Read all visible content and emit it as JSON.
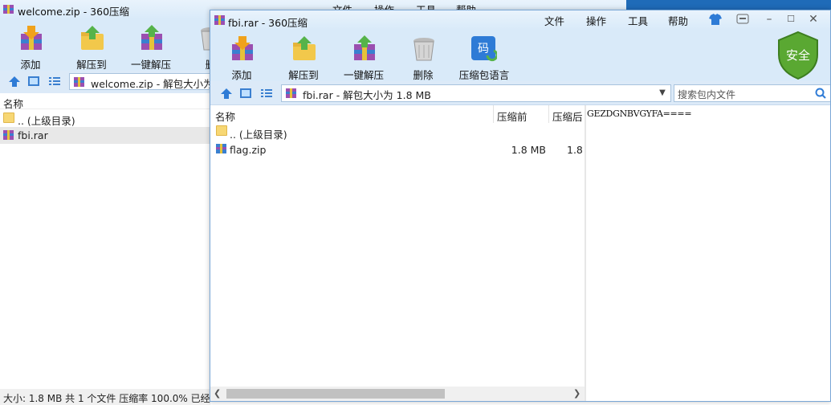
{
  "background_window": {
    "title": "welcome.zip - 360压缩",
    "menu": [
      "文件",
      "操作",
      "工具",
      "帮助"
    ],
    "toolbar": [
      {
        "label": "添加",
        "icon": "add-archive-icon"
      },
      {
        "label": "解压到",
        "icon": "extract-to-icon"
      },
      {
        "label": "一键解压",
        "icon": "quick-extract-icon"
      },
      {
        "label": "删",
        "icon": "delete-icon"
      }
    ],
    "path": "welcome.zip - 解包大小为",
    "column_name": "名称",
    "rows": [
      {
        "name": ".. (上级目录)",
        "icon": "folder-icon"
      },
      {
        "name": "fbi.rar",
        "icon": "rar-archive-icon"
      }
    ],
    "status": "大小: 1.8 MB 共 1 个文件 压缩率 100.0% 已经"
  },
  "foreground_window": {
    "title": "fbi.rar - 360压缩",
    "menu": [
      "文件",
      "操作",
      "工具",
      "帮助"
    ],
    "toolbar": [
      {
        "label": "添加",
        "icon": "add-archive-icon"
      },
      {
        "label": "解压到",
        "icon": "extract-to-icon"
      },
      {
        "label": "一键解压",
        "icon": "quick-extract-icon"
      },
      {
        "label": "删除",
        "icon": "delete-icon"
      },
      {
        "label": "压缩包语言",
        "icon": "archive-language-icon"
      }
    ],
    "security_badge": "安全",
    "path": "fbi.rar - 解包大小为 1.8 MB",
    "search_placeholder": "搜索包内文件",
    "columns": {
      "name": "名称",
      "before": "压缩前",
      "after": "压缩后"
    },
    "rows": [
      {
        "name": ".. (上级目录)",
        "before": "",
        "after": "",
        "icon": "folder-icon"
      },
      {
        "name": "flag.zip",
        "before": "1.8 MB",
        "after": "1.8",
        "icon": "zip-archive-icon"
      }
    ],
    "preview_text": "GEZDGNBVGYFA===="
  },
  "colors": {
    "titlebar": "#dcebfa",
    "toolbar": "#d9eaf9",
    "security_green": "#5aa832",
    "accent_blue": "#2e7bd6"
  }
}
